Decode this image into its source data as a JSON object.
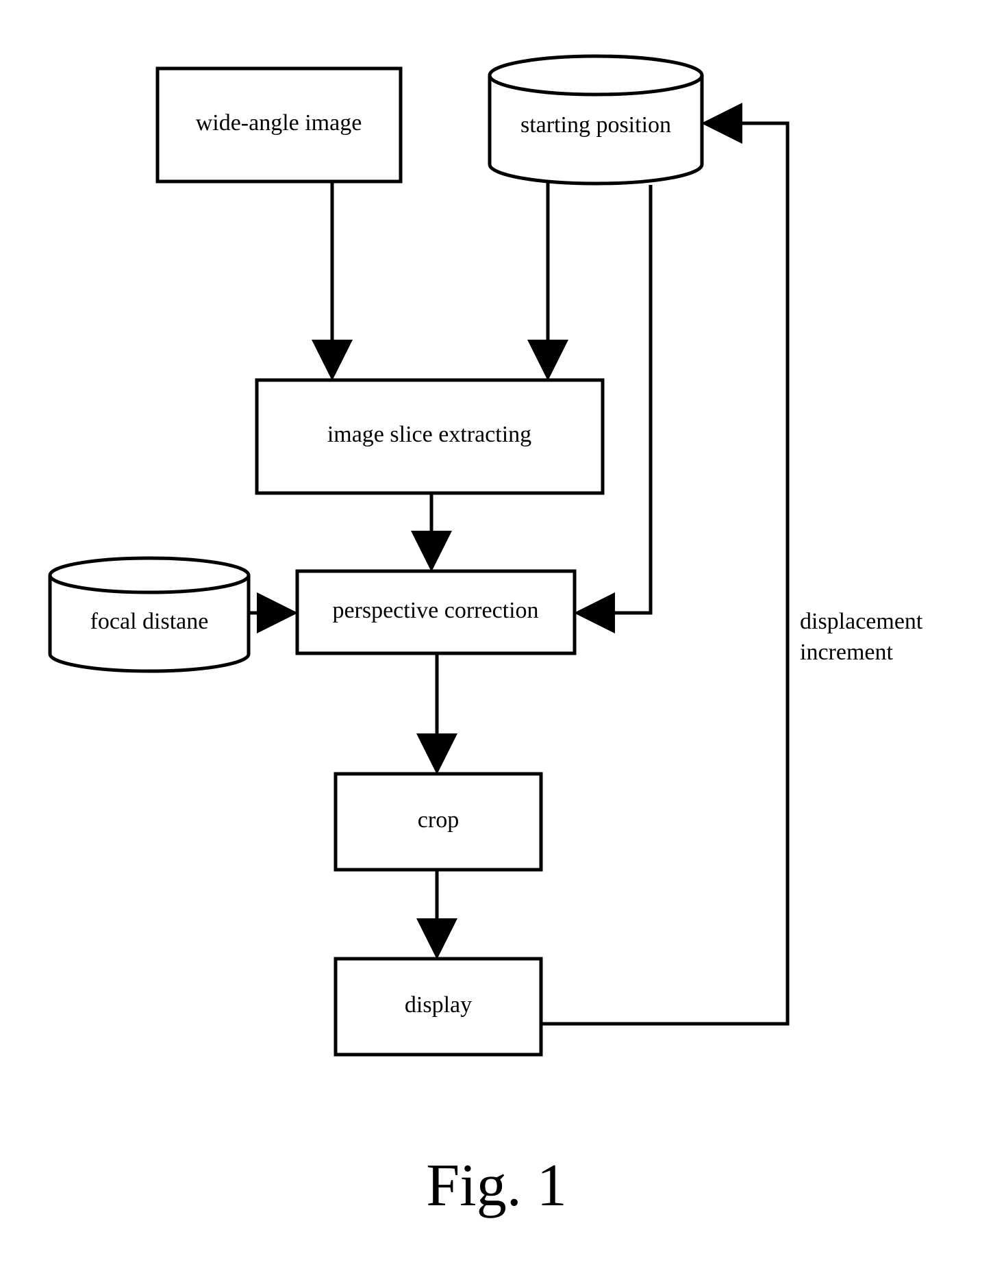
{
  "nodes": {
    "wide_angle": {
      "label": "wide-angle image"
    },
    "starting_pos": {
      "label": "starting position"
    },
    "slice": {
      "label": "image slice extracting"
    },
    "perspective": {
      "label": "perspective correction"
    },
    "focal": {
      "label": "focal distane"
    },
    "crop": {
      "label": "crop"
    },
    "display": {
      "label": "display"
    }
  },
  "labels": {
    "disp_inc_line1": "displacement",
    "disp_inc_line2": "increment"
  },
  "caption": "Fig. 1"
}
